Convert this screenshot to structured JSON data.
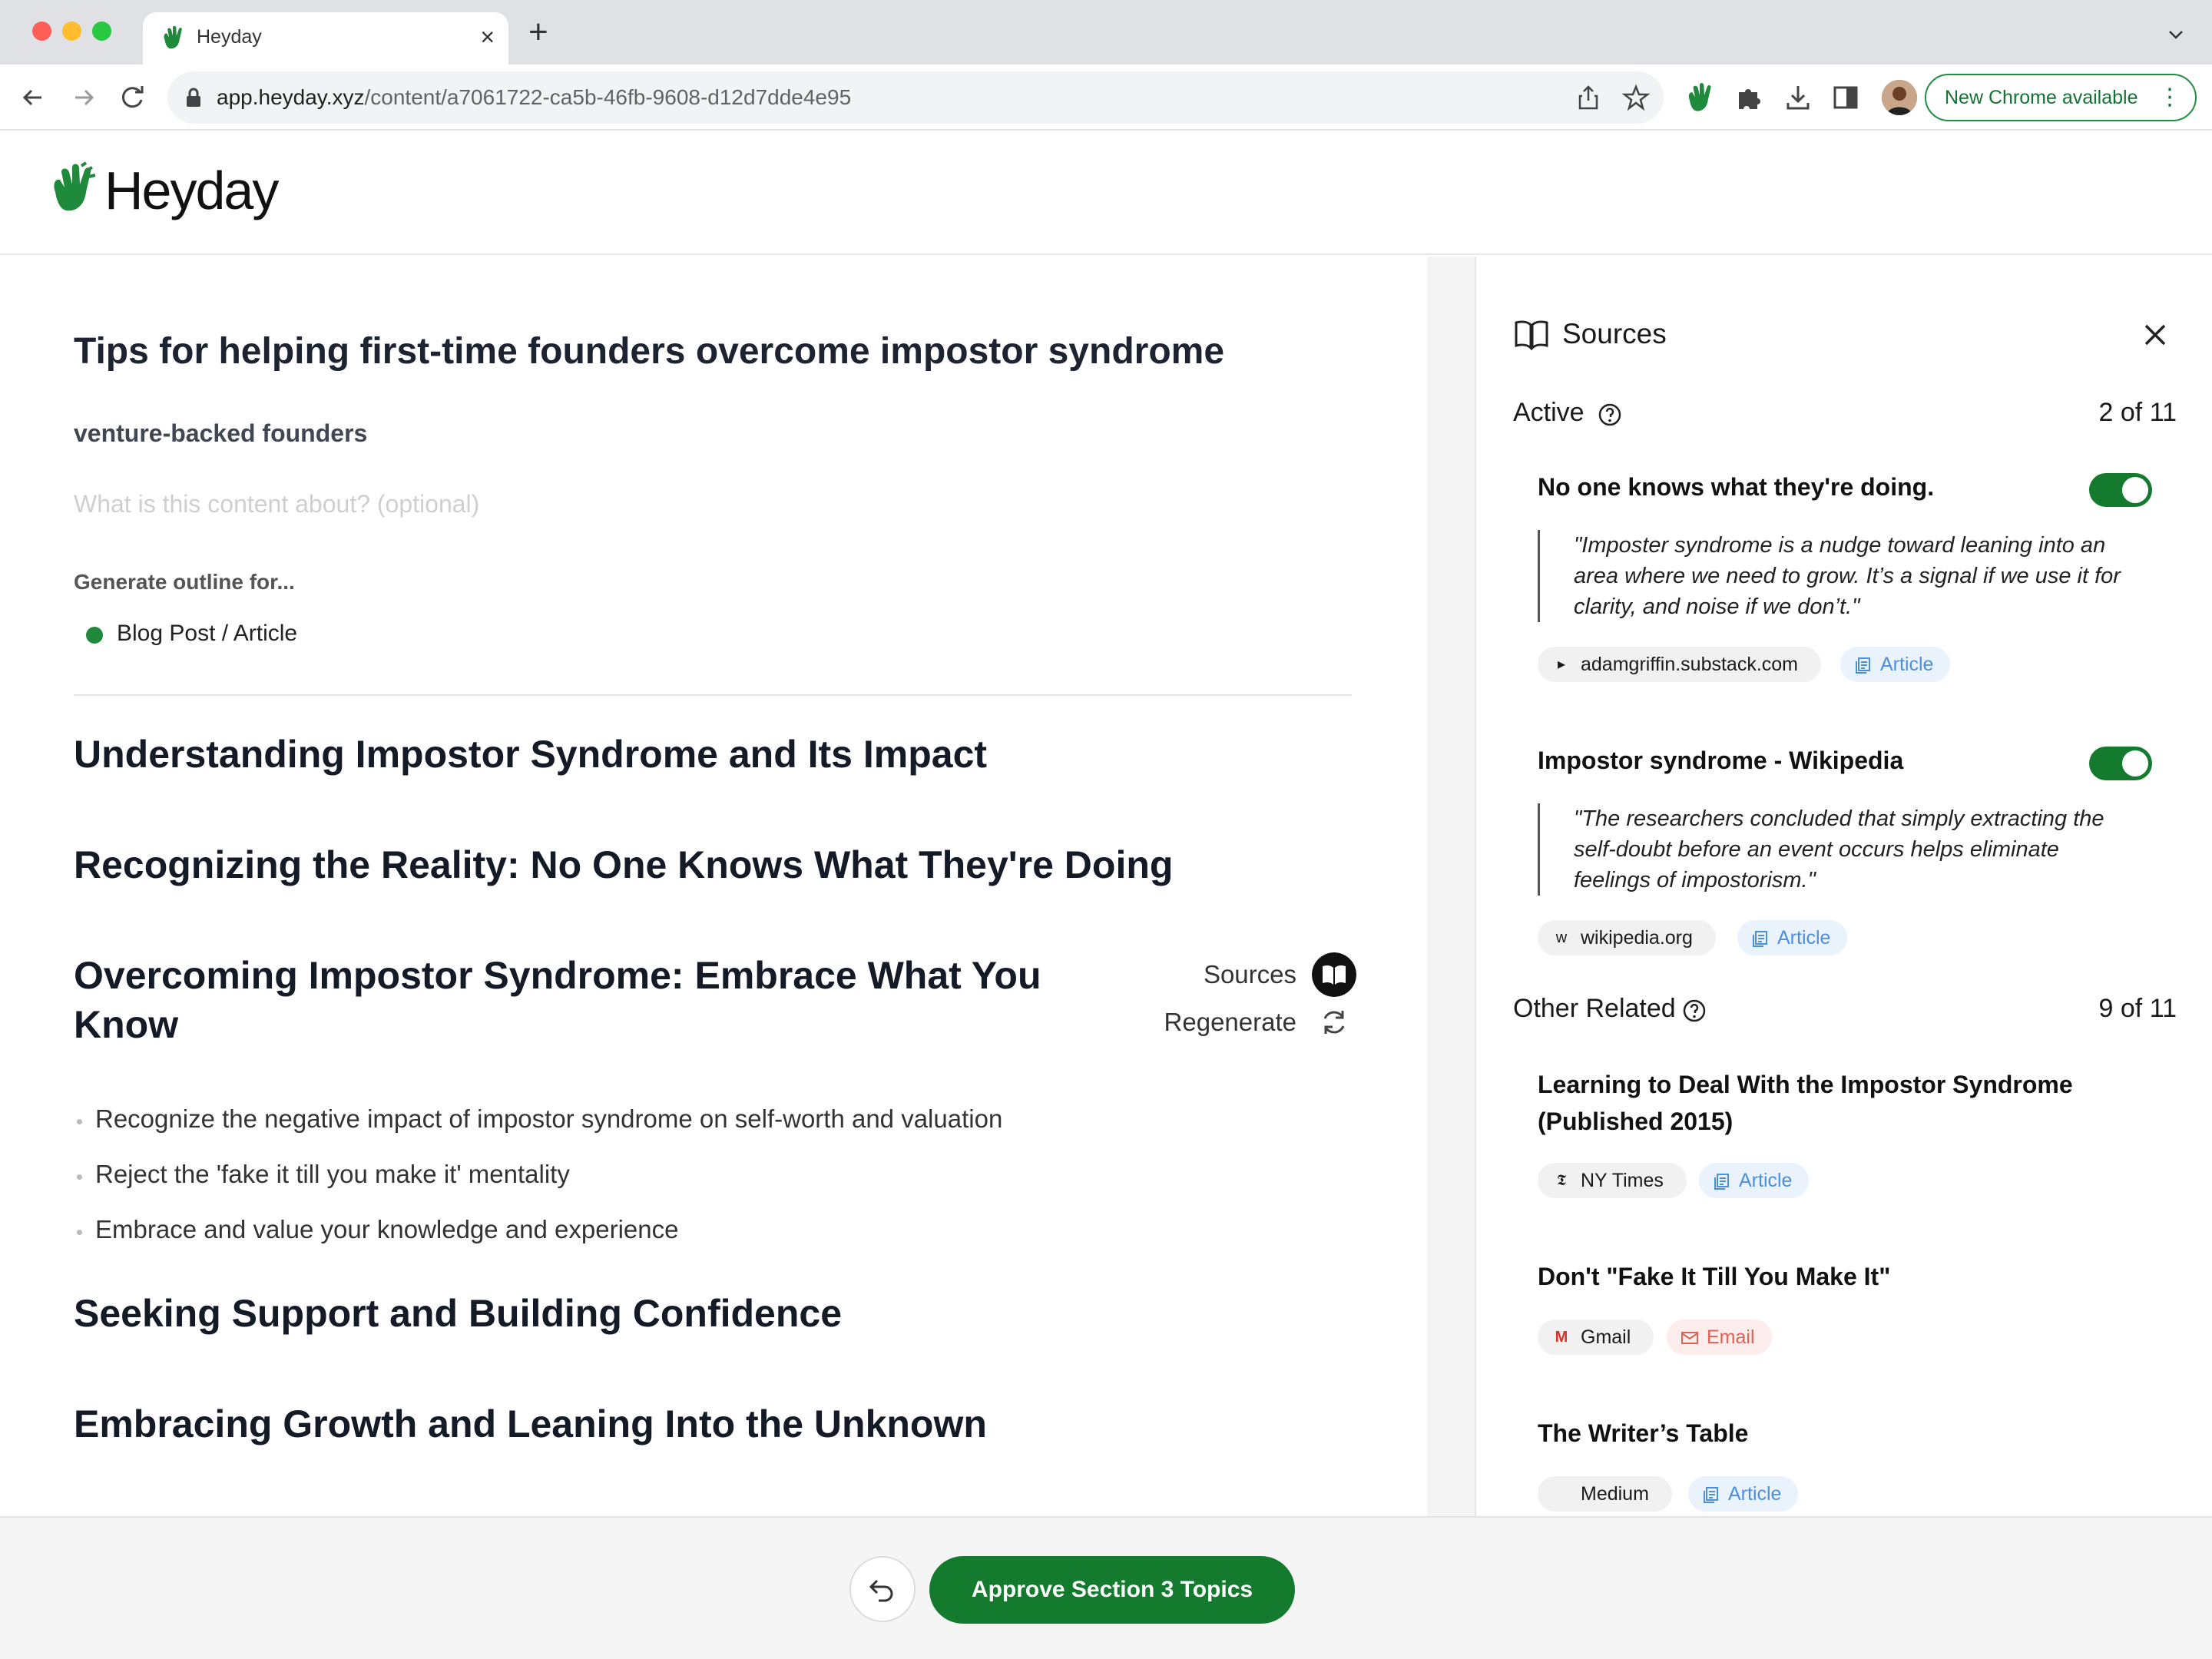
{
  "browser": {
    "tab_title": "Heyday",
    "new_tab_symbol": "+",
    "close_symbol": "×",
    "url_host": "app.heyday.xyz",
    "url_path": "/content/a7061722-ca5b-46fb-9608-d12d7dde4e95",
    "update_button": "New Chrome available",
    "update_menu": "⋮"
  },
  "app": {
    "logo_text": "Heyday",
    "brand_color": "#137a2e"
  },
  "doc": {
    "title": "Tips for helping first-time founders overcome impostor syndrome",
    "audience": "venture-backed founders",
    "about_placeholder": "What is this content about? (optional)",
    "about_value": "",
    "generate_label": "Generate outline for...",
    "format": "Blog Post / Article"
  },
  "sections": [
    {
      "heading": "Understanding Impostor Syndrome and Its Impact"
    },
    {
      "heading": "Recognizing the Reality: No One Knows What They're Doing"
    },
    {
      "heading": "Overcoming Impostor Syndrome: Embrace What You Know",
      "actions": {
        "sources": "Sources",
        "regenerate": "Regenerate"
      },
      "bullets": [
        "Recognize the negative impact of impostor syndrome on self-worth and valuation",
        "Reject the 'fake it till you make it' mentality",
        "Embrace and value your knowledge and experience"
      ]
    },
    {
      "heading": "Seeking Support and Building Confidence"
    },
    {
      "heading": "Embracing Growth and Leaning Into the Unknown"
    }
  ],
  "bottom": {
    "approve": "Approve Section 3 Topics"
  },
  "panel": {
    "title": "Sources",
    "active": {
      "label": "Active",
      "count": "2 of 11",
      "items": [
        {
          "title": "No one knows what they're doing.",
          "enabled": true,
          "quote": "\"Imposter syndrome is a nudge toward leaning into an area where we need to grow. It’s a signal if we use it for clarity, and noise if we don’t.\"",
          "source": "adamgriffin.substack.com",
          "source_icon": "▸",
          "type": "Article"
        },
        {
          "title": "Impostor syndrome - Wikipedia",
          "enabled": true,
          "quote": "\"The researchers concluded that simply extracting the self-doubt before an event occurs helps eliminate feelings of impostorism.\"",
          "source": "wikipedia.org",
          "source_icon": "w",
          "type": "Article"
        }
      ]
    },
    "other": {
      "label": "Other Related",
      "count": "9 of 11",
      "items": [
        {
          "title": "Learning to Deal With the Impostor Syndrome (Published 2015)",
          "source": "NY Times",
          "source_icon": "𝕿",
          "type": "Article"
        },
        {
          "title": "Don't \"Fake It Till You Make It\"",
          "source": "Gmail",
          "source_icon": "M",
          "type": "Email"
        },
        {
          "title": "The Writer’s Table",
          "source": "Medium",
          "source_icon": "",
          "type": "Article"
        }
      ]
    }
  }
}
